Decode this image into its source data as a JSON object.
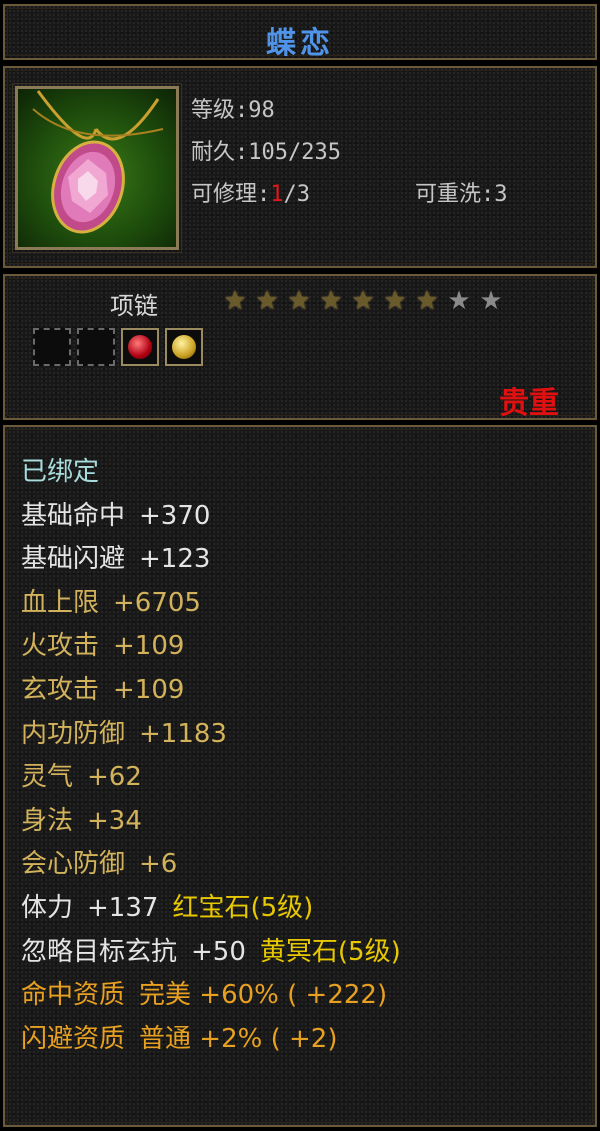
{
  "item": {
    "name": "蝶恋",
    "level": "等级:98",
    "durability": "耐久:105/235",
    "repair_label": "可修理:",
    "repair_used": "1",
    "repair_total": "/3",
    "rewash": "可重洗:3",
    "type": "项链",
    "stars_filled": 7,
    "stars_total": 9,
    "precious": "贵重",
    "colors": {
      "title": "#4f94e8",
      "precious": "#e01010",
      "attr": "#d2b25a",
      "quality": "#e8a020"
    }
  },
  "sockets": [
    {
      "state": "empty"
    },
    {
      "state": "empty"
    },
    {
      "state": "red-gem-icon"
    },
    {
      "state": "yellow-gem-icon"
    }
  ],
  "stats": [
    {
      "label": "已绑定",
      "value": "",
      "extra": "",
      "style": "cyan"
    },
    {
      "label": "基础命中",
      "value": "+370",
      "extra": "",
      "style": "white"
    },
    {
      "label": "基础闪避",
      "value": "+123",
      "extra": "",
      "style": "white"
    },
    {
      "label": "血上限",
      "value": "+6705",
      "extra": "",
      "style": "gold"
    },
    {
      "label": "火攻击",
      "value": "+109",
      "extra": "",
      "style": "gold"
    },
    {
      "label": "玄攻击",
      "value": "+109",
      "extra": "",
      "style": "gold"
    },
    {
      "label": "内功防御",
      "value": "+1183",
      "extra": "",
      "style": "gold"
    },
    {
      "label": "灵气",
      "value": "+62",
      "extra": "",
      "style": "gold"
    },
    {
      "label": "身法",
      "value": "+34",
      "extra": "",
      "style": "gold"
    },
    {
      "label": "会心防御",
      "value": "+6",
      "extra": "",
      "style": "gold"
    },
    {
      "label": "体力",
      "value": "+137",
      "extra": "红宝石(5级)",
      "style": "white"
    },
    {
      "label": "忽略目标玄抗",
      "value": "+50",
      "extra": "黄冥石(5级)",
      "style": "white"
    },
    {
      "label": "命中资质",
      "value": "完美 +60% ( +222)",
      "extra": "",
      "style": "orange"
    },
    {
      "label": "闪避资质",
      "value": "普通 +2% ( +2)",
      "extra": "",
      "style": "orange"
    }
  ]
}
